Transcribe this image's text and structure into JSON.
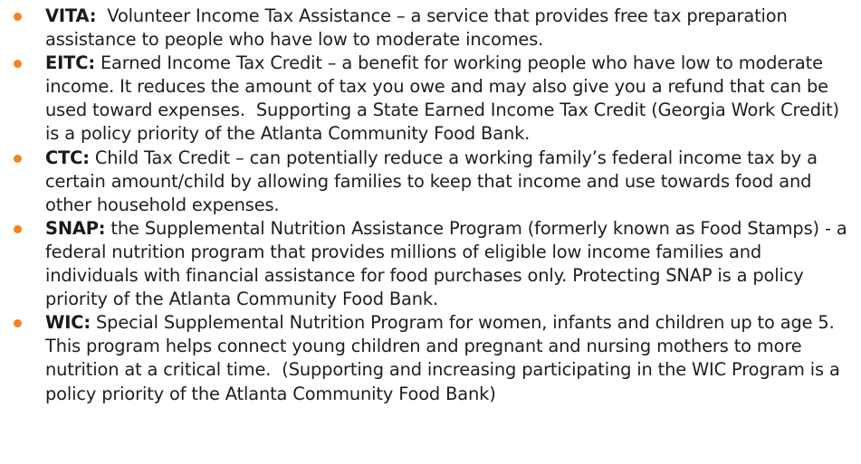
{
  "colors": {
    "bullet": "#f58220",
    "text": "#1e1e1e"
  },
  "items": [
    {
      "term": "VITA:",
      "text": "  Volunteer Income Tax Assistance – a service that provides free tax preparation assistance to people who have low to moderate incomes."
    },
    {
      "term": "EITC:",
      "text": " Earned Income Tax Credit – a benefit for working people who have low to moderate income. It reduces the amount of tax you owe and may also give you a refund that can be used toward expenses.  Supporting a State Earned Income Tax Credit (Georgia Work Credit) is a policy priority of the Atlanta Community Food Bank."
    },
    {
      "term": "CTC:",
      "text": " Child Tax Credit – can potentially reduce a working family’s federal income tax by a certain amount/child by allowing families to keep that income and use towards food and other household expenses."
    },
    {
      "term": "SNAP:",
      "text": " the Supplemental Nutrition Assistance Program (formerly known as Food Stamps) - a federal nutrition program that provides millions of eligible low income families and individuals with financial assistance for food purchases only. Protecting SNAP is a policy priority of the Atlanta Community Food Bank."
    },
    {
      "term": "WIC:",
      "text": " Special Supplemental Nutrition Program for women, infants and children up to age 5. This program helps connect young children and pregnant and nursing mothers to more nutrition at a critical time.  (Supporting and increasing participating in the WIC Program is a policy priority of the Atlanta Community Food Bank)"
    }
  ]
}
